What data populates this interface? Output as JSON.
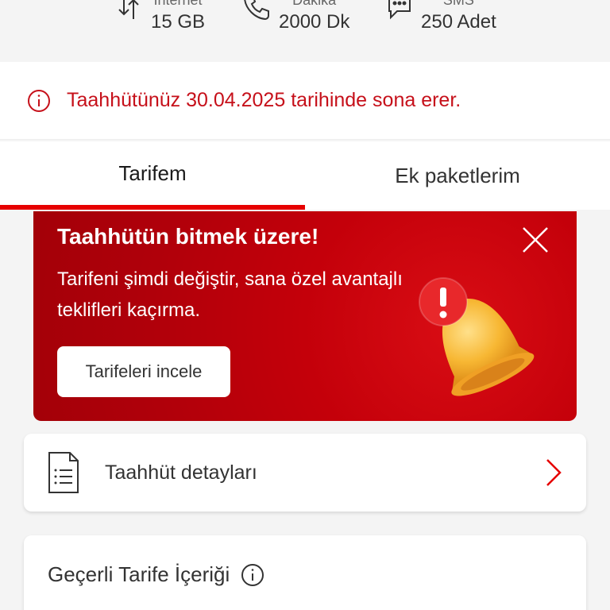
{
  "usage": {
    "items": [
      {
        "label": "İnternet",
        "value": "15 GB",
        "icon": "data-transfer-icon"
      },
      {
        "label": "Dakika",
        "value": "2000 Dk",
        "icon": "phone-icon"
      },
      {
        "label": "SMS",
        "value": "250 Adet",
        "icon": "message-icon"
      }
    ]
  },
  "alert": {
    "text": "Taahhütünüz 30.04.2025 tarihinde sona erer.",
    "icon": "info-icon",
    "color": "#c6101a"
  },
  "tabs": [
    {
      "label": "Tarifem",
      "active": true
    },
    {
      "label": "Ek paketlerim",
      "active": false
    }
  ],
  "promo": {
    "title": "Taahhütün bitmek üzere!",
    "description": "Tarifeni şimdi değiştir, sana özel avantajlı teklifleri kaçırma.",
    "button_label": "Tarifeleri incele",
    "close_icon": "close-icon",
    "image": "bell-alert-icon",
    "color": "#c4000a"
  },
  "commitment_details": {
    "label": "Taahhüt detayları",
    "icon": "document-icon"
  },
  "tariff_content": {
    "title": "Geçerli Tarife İçeriği",
    "icon": "info-icon"
  },
  "colors": {
    "accent": "#e60000",
    "background": "#f4f4f4"
  }
}
